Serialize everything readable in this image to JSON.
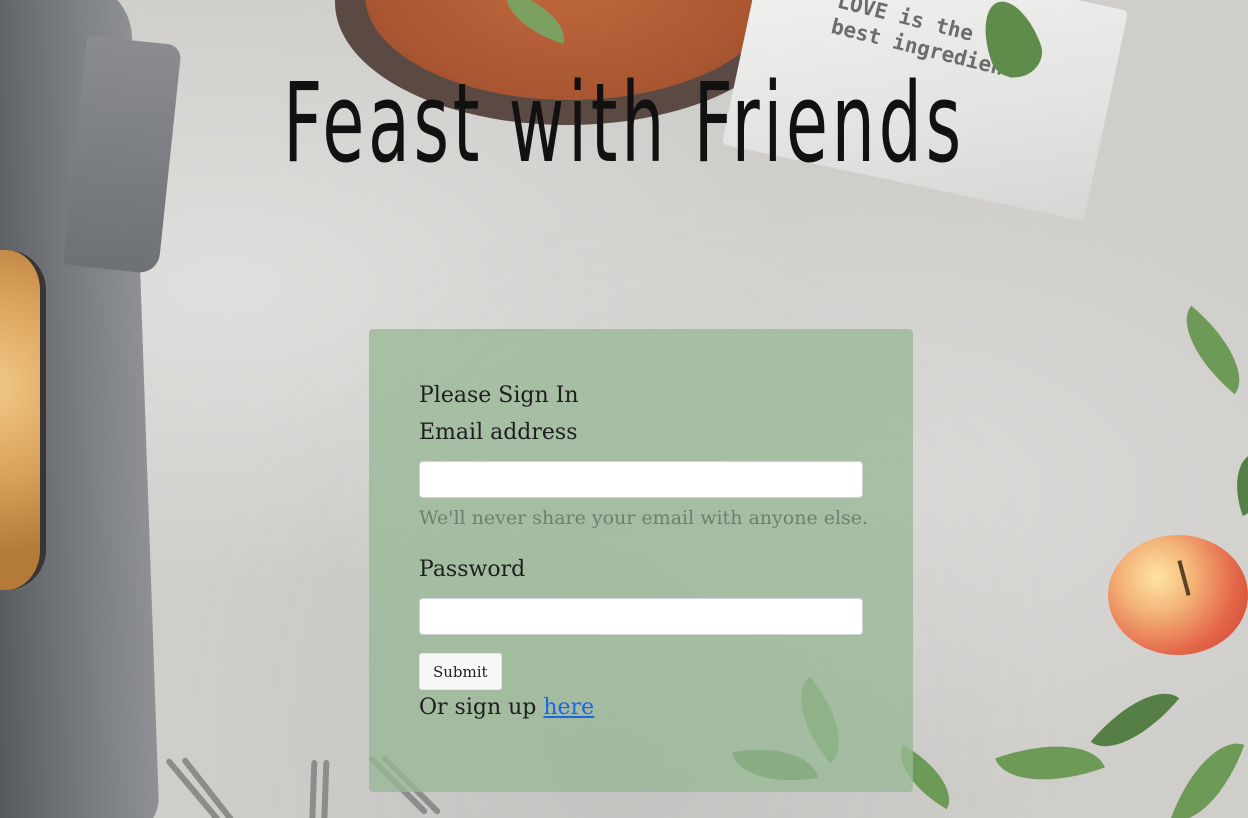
{
  "page": {
    "title": "Feast with Friends"
  },
  "background": {
    "napkin_text": "LOVE is the\nbest ingredient"
  },
  "signin": {
    "heading": "Please Sign In",
    "email_label": "Email address",
    "email_value": "",
    "email_help": "We'll never share your email with anyone else.",
    "password_label": "Password",
    "password_value": "",
    "submit_label": "Submit",
    "signup_prefix": "Or sign up ",
    "signup_link": "here"
  },
  "colors": {
    "card_background": "#99b996",
    "link": "#1a66e8",
    "title": "#111111"
  }
}
